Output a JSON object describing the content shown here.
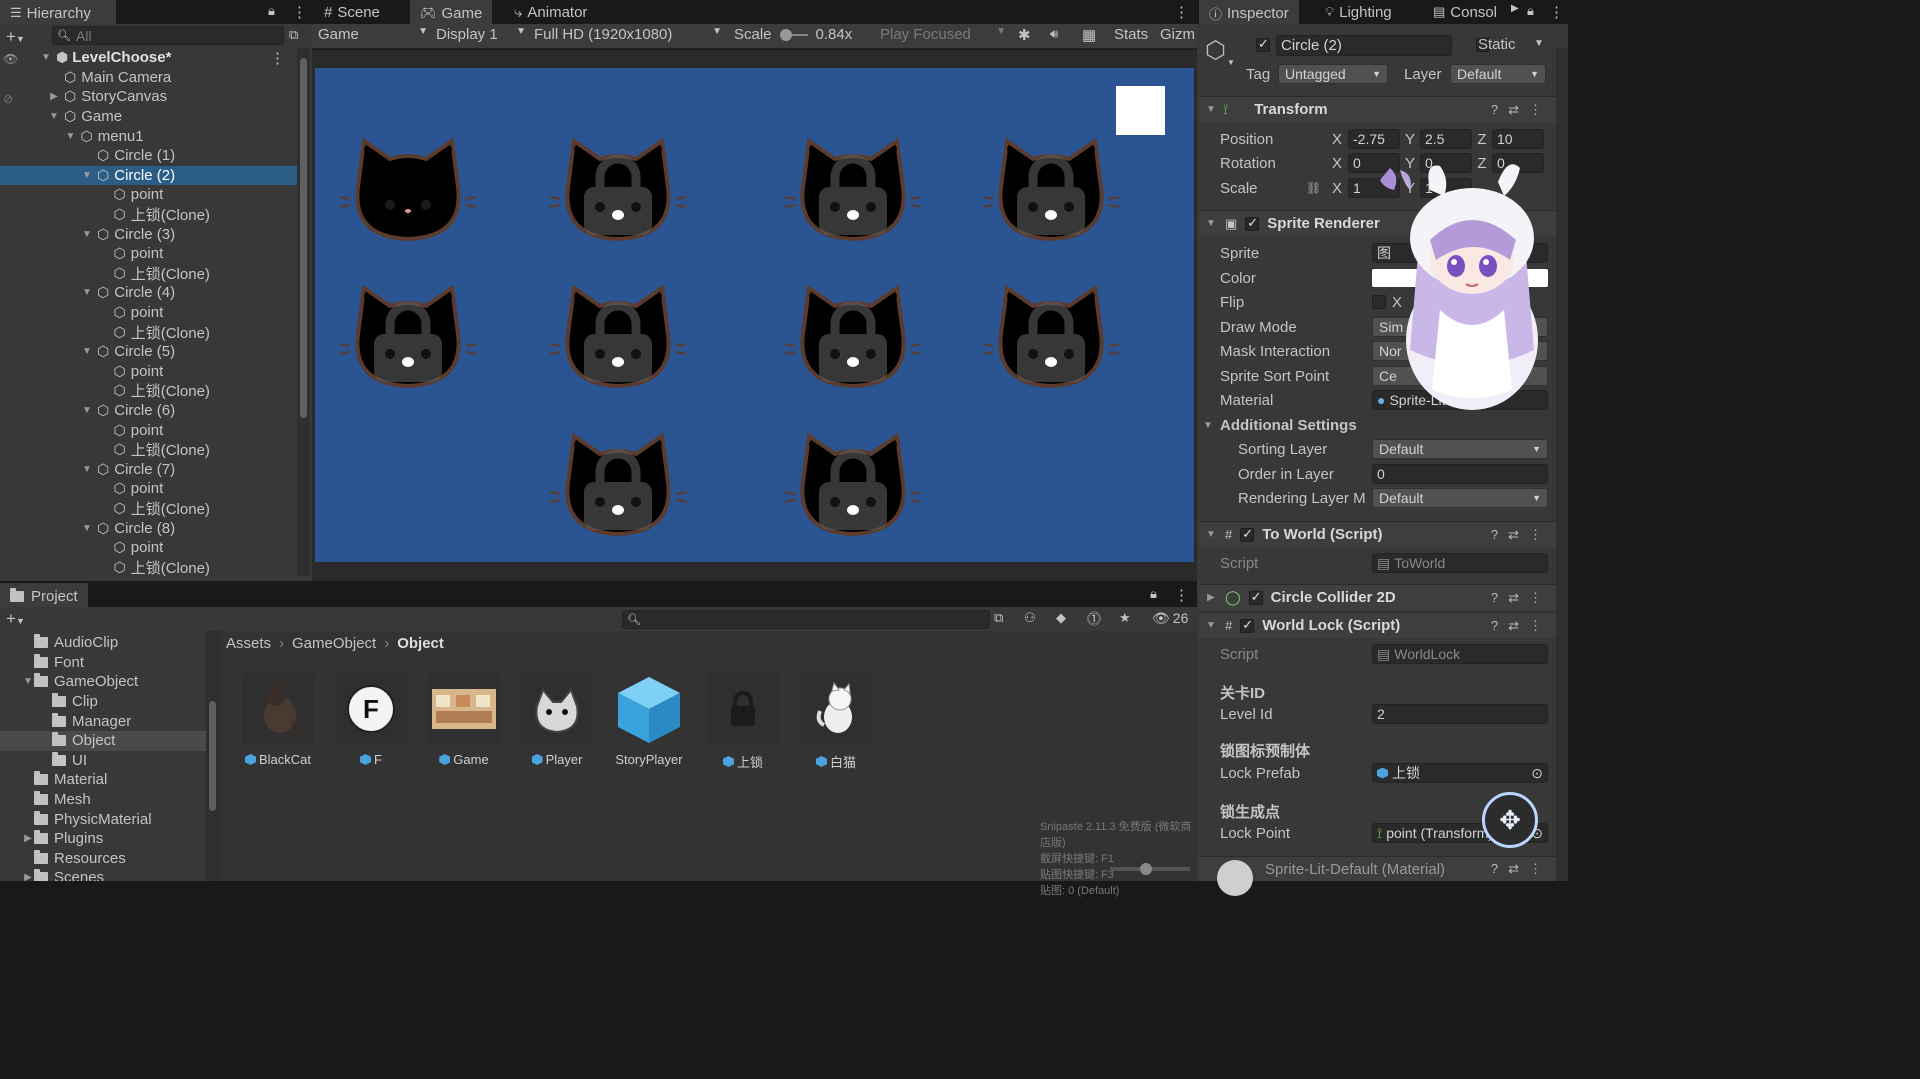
{
  "hierarchy": {
    "tab": "Hierarchy",
    "search_placeholder": "All",
    "root": "LevelChoose*",
    "items": [
      {
        "label": "Main Camera",
        "indent": 1,
        "arrow": ""
      },
      {
        "label": "StoryCanvas",
        "indent": 1,
        "arrow": "▶"
      },
      {
        "label": "Game",
        "indent": 1,
        "arrow": "▼"
      },
      {
        "label": "menu1",
        "indent": 2,
        "arrow": "▼"
      },
      {
        "label": "Circle (1)",
        "indent": 3,
        "arrow": ""
      },
      {
        "label": "Circle (2)",
        "indent": 3,
        "arrow": "▼",
        "selected": true
      },
      {
        "label": "point",
        "indent": 4,
        "arrow": ""
      },
      {
        "label": "上锁(Clone)",
        "indent": 4,
        "arrow": ""
      },
      {
        "label": "Circle (3)",
        "indent": 3,
        "arrow": "▼"
      },
      {
        "label": "point",
        "indent": 4,
        "arrow": ""
      },
      {
        "label": "上锁(Clone)",
        "indent": 4,
        "arrow": ""
      },
      {
        "label": "Circle (4)",
        "indent": 3,
        "arrow": "▼"
      },
      {
        "label": "point",
        "indent": 4,
        "arrow": ""
      },
      {
        "label": "上锁(Clone)",
        "indent": 4,
        "arrow": ""
      },
      {
        "label": "Circle (5)",
        "indent": 3,
        "arrow": "▼"
      },
      {
        "label": "point",
        "indent": 4,
        "arrow": ""
      },
      {
        "label": "上锁(Clone)",
        "indent": 4,
        "arrow": ""
      },
      {
        "label": "Circle (6)",
        "indent": 3,
        "arrow": "▼"
      },
      {
        "label": "point",
        "indent": 4,
        "arrow": ""
      },
      {
        "label": "上锁(Clone)",
        "indent": 4,
        "arrow": ""
      },
      {
        "label": "Circle (7)",
        "indent": 3,
        "arrow": "▼"
      },
      {
        "label": "point",
        "indent": 4,
        "arrow": ""
      },
      {
        "label": "上锁(Clone)",
        "indent": 4,
        "arrow": ""
      },
      {
        "label": "Circle (8)",
        "indent": 3,
        "arrow": "▼"
      },
      {
        "label": "point",
        "indent": 4,
        "arrow": ""
      },
      {
        "label": "上锁(Clone)",
        "indent": 4,
        "arrow": ""
      }
    ]
  },
  "game_view": {
    "tabs": {
      "scene": "Scene",
      "game": "Game",
      "animator": "Animator"
    },
    "toolbar": {
      "mode": "Game",
      "display": "Display 1",
      "resolution": "Full HD (1920x1080)",
      "scale_label": "Scale",
      "scale_value": "0.84x",
      "play_mode": "Play Focused",
      "stats": "Stats",
      "gizmos": "Gizm"
    },
    "background": "#2b5592",
    "cats": [
      {
        "colors": [
          "#9e9e9e",
          "#f2c27a",
          "#ffffff"
        ],
        "locked": false
      },
      {
        "colors": [
          "#d98b3a",
          "#6b4a38",
          "#f4e2c8"
        ],
        "locked": true
      },
      {
        "colors": [
          "#b0b0b0",
          "#9a9a9a",
          "#ececec"
        ],
        "locked": true
      },
      {
        "colors": [
          "#555555",
          "#777777",
          "#e6e6e6"
        ],
        "locked": true
      },
      {
        "colors": [
          "#b88f76",
          "#7d5e4e",
          "#efe3da"
        ],
        "locked": true
      },
      {
        "colors": [
          "#f2d9b4",
          "#d8b48c",
          "#fff5e8"
        ],
        "locked": true
      },
      {
        "colors": [
          "#2e221e",
          "#d07a2e",
          "#f2f2f2"
        ],
        "locked": true
      },
      {
        "colors": [
          "#c9947a",
          "#ead6c8",
          "#f7ece4"
        ],
        "locked": true
      },
      {
        "colors": [
          "#f0b3b3",
          "#e59c9c",
          "#ffe8e8"
        ],
        "locked": true
      },
      {
        "colors": [
          "#a99ad6",
          "#8a7bc4",
          "#ece8f8"
        ],
        "locked": true
      }
    ]
  },
  "inspector": {
    "tabs": {
      "inspector": "Inspector",
      "lighting": "Lighting",
      "console": "Consol"
    },
    "object_name": "Circle (2)",
    "static_label": "Static",
    "tag_label": "Tag",
    "tag_value": "Untagged",
    "layer_label": "Layer",
    "layer_value": "Default",
    "transform": {
      "title": "Transform",
      "position_label": "Position",
      "rotation_label": "Rotation",
      "scale_label": "Scale",
      "pos": {
        "x": "-2.75",
        "y": "2.5",
        "z": "10"
      },
      "rot": {
        "x": "0",
        "y": "0",
        "z": "0"
      },
      "scl": {
        "x": "1",
        "y": "1"
      }
    },
    "sprite_renderer": {
      "title": "Sprite Renderer",
      "sprite_label": "Sprite",
      "sprite_value": "图",
      "color_label": "Color",
      "flip_label": "Flip",
      "flip_value": "X",
      "draw_mode_label": "Draw Mode",
      "draw_mode_value": "Sim",
      "mask_label": "Mask Interaction",
      "mask_value": "Nor",
      "sort_point_label": "Sprite Sort Point",
      "sort_point_value": "Ce",
      "material_label": "Material",
      "material_value": "Sprite-Lit-Default",
      "additional": "Additional Settings",
      "sorting_layer_label": "Sorting Layer",
      "sorting_layer_value": "Default",
      "order_label": "Order in Layer",
      "order_value": "0",
      "rendering_label": "Rendering Layer M",
      "rendering_value": "Default"
    },
    "to_world": {
      "title": "To World (Script)",
      "script_label": "Script",
      "script_value": "ToWorld"
    },
    "collider": {
      "title": "Circle Collider 2D"
    },
    "world_lock": {
      "title": "World Lock (Script)",
      "script_label": "Script",
      "script_value": "WorldLock",
      "header1": "关卡ID",
      "level_label": "Level Id",
      "level_value": "2",
      "header2": "锁图标预制体",
      "lock_prefab_label": "Lock Prefab",
      "lock_prefab_value": "上锁",
      "header3": "锁生成点",
      "lock_point_label": "Lock Point",
      "lock_point_value": "point (Transform)"
    },
    "material_footer": "Sprite-Lit-Default (Material)"
  },
  "project": {
    "tab": "Project",
    "count": "26",
    "breadcrumb": [
      "Assets",
      "GameObject",
      "Object"
    ],
    "folders": [
      {
        "label": "AudioClip",
        "indent": 0,
        "arrow": ""
      },
      {
        "label": "Font",
        "indent": 0,
        "arrow": ""
      },
      {
        "label": "GameObject",
        "indent": 0,
        "arrow": "▼"
      },
      {
        "label": "Clip",
        "indent": 1,
        "arrow": ""
      },
      {
        "label": "Manager",
        "indent": 1,
        "arrow": ""
      },
      {
        "label": "Object",
        "indent": 1,
        "arrow": "",
        "selected": true
      },
      {
        "label": "UI",
        "indent": 1,
        "arrow": ""
      },
      {
        "label": "Material",
        "indent": 0,
        "arrow": ""
      },
      {
        "label": "Mesh",
        "indent": 0,
        "arrow": ""
      },
      {
        "label": "PhysicMaterial",
        "indent": 0,
        "arrow": ""
      },
      {
        "label": "Plugins",
        "indent": 0,
        "arrow": "▶"
      },
      {
        "label": "Resources",
        "indent": 0,
        "arrow": ""
      },
      {
        "label": "Scenes",
        "indent": 0,
        "arrow": "▶"
      }
    ],
    "assets": [
      {
        "label": "BlackCat",
        "thumb": "blackcat"
      },
      {
        "label": "F",
        "thumb": "f"
      },
      {
        "label": "Game",
        "thumb": "game"
      },
      {
        "label": "Player",
        "thumb": "player"
      },
      {
        "label": "StoryPlayer",
        "thumb": "storyplayer"
      },
      {
        "label": "上锁",
        "thumb": "lock"
      },
      {
        "label": "白猫",
        "thumb": "whitecat"
      }
    ]
  },
  "watermark": {
    "line1": "Snipaste 2.11.3 免费版 (微软商店版)",
    "line2": "截屏快捷键: F1",
    "line3": "贴图快捷键: F3",
    "line4": "贴图: 0 (Default)"
  }
}
